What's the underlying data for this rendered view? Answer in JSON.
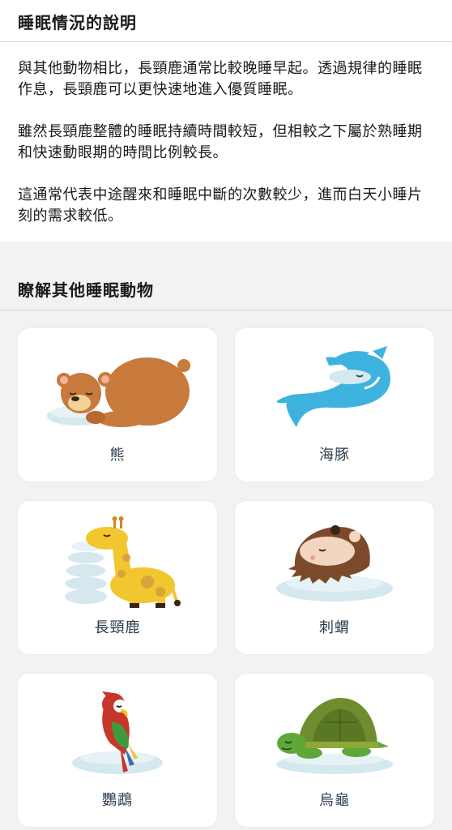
{
  "info": {
    "title": "睡眠情況的說明",
    "paragraphs": [
      "與其他動物相比，長頸鹿通常比較晚睡早起。透過規律的睡眠作息，長頸鹿可以更快速地進入優質睡眠。",
      "雖然長頸鹿整體的睡眠持續時間較短，但相較之下屬於熟睡期和快速動眼期的時間比例較長。",
      "這通常代表中途醒來和睡眠中斷的次數較少，進而白天小睡片刻的需求較低。"
    ]
  },
  "others": {
    "title": "瞭解其他睡眠動物",
    "animals": [
      {
        "label": "熊",
        "icon": "bear-icon"
      },
      {
        "label": "海豚",
        "icon": "dolphin-icon"
      },
      {
        "label": "長頸鹿",
        "icon": "giraffe-icon"
      },
      {
        "label": "刺蝟",
        "icon": "hedgehog-icon"
      },
      {
        "label": "鸚鵡",
        "icon": "parrot-icon"
      },
      {
        "label": "烏龜",
        "icon": "turtle-icon"
      }
    ]
  },
  "colors": {
    "pillow": "#d4e8ee",
    "bear": "#c77a3c",
    "dolphin": "#3fb3e0",
    "giraffe": "#f2c62f",
    "hedgehog": "#7a4a2a",
    "parrot": "#c8352a",
    "turtle": "#6f8d2e"
  }
}
